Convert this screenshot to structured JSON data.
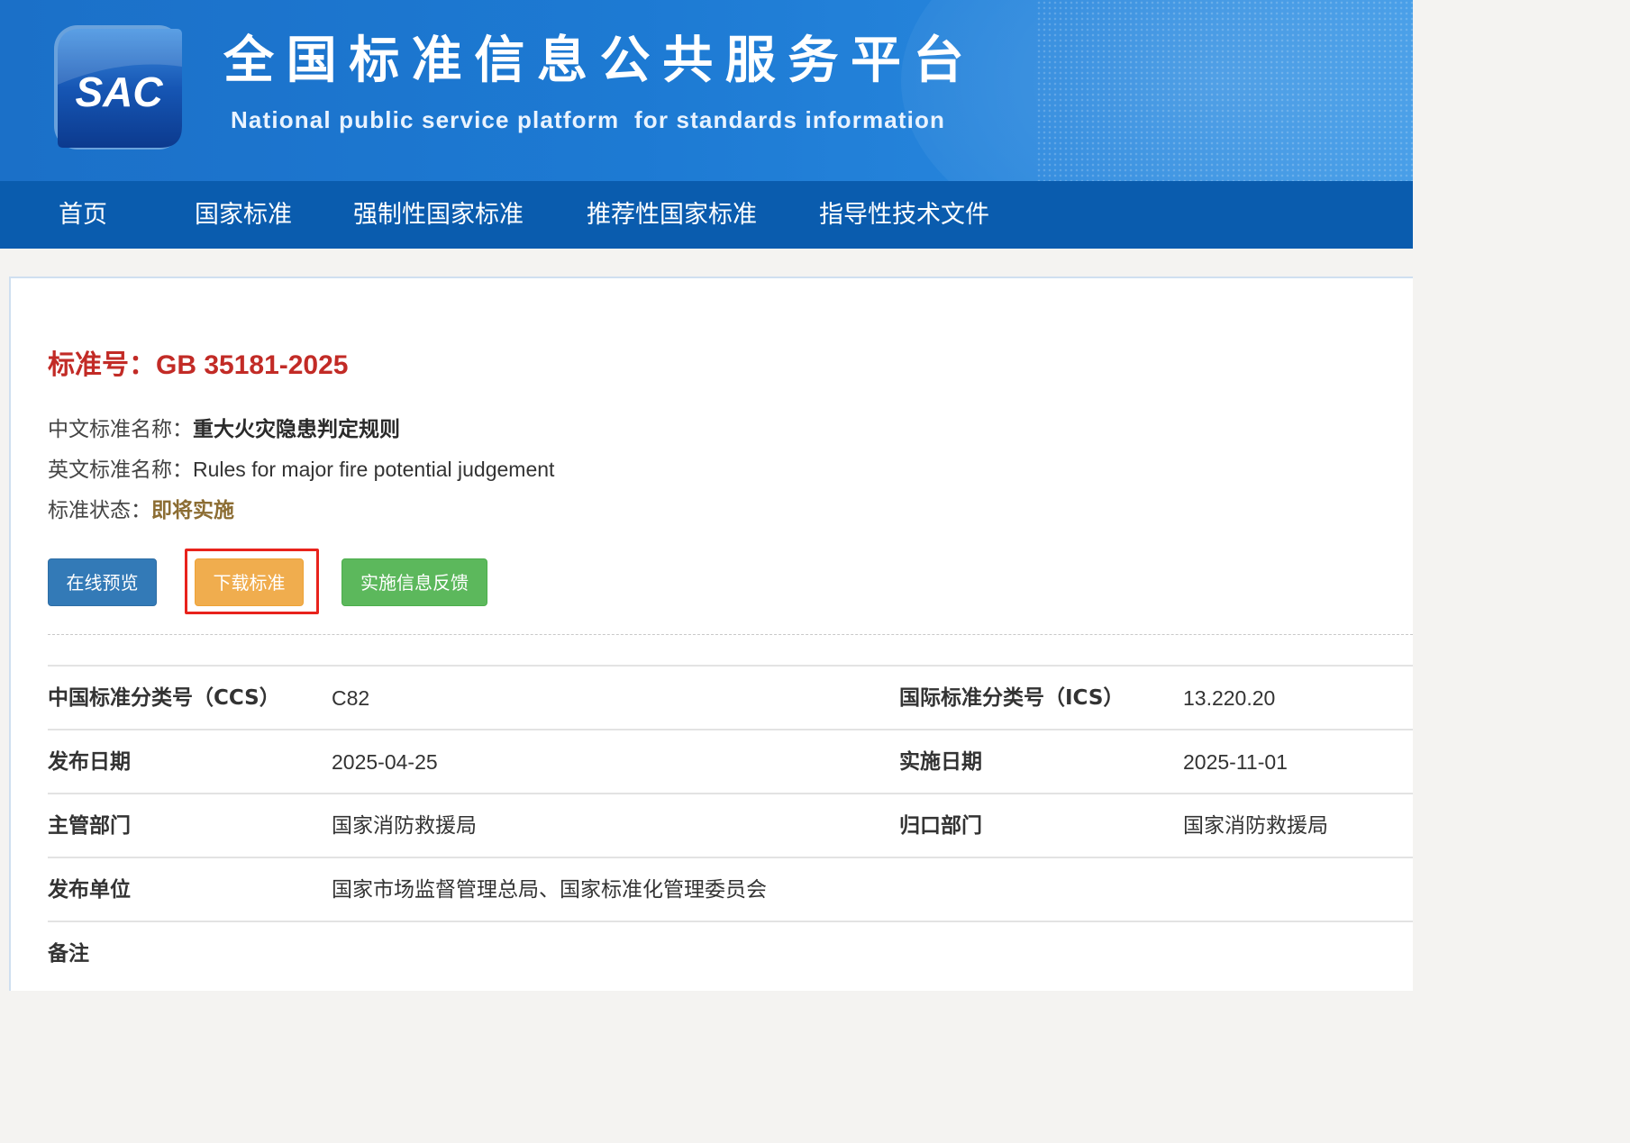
{
  "header": {
    "logo_text": "SAC",
    "title": "全国标准信息公共服务平台",
    "subtitle": "National public service platform  for standards information"
  },
  "nav": {
    "items": [
      {
        "label": "首页"
      },
      {
        "label": "国家标准"
      },
      {
        "label": "强制性国家标准"
      },
      {
        "label": "推荐性国家标准"
      },
      {
        "label": "指导性技术文件"
      }
    ]
  },
  "standard": {
    "number_label": "标准号：",
    "number": "GB 35181-2025",
    "cn_name_label": "中文标准名称：",
    "cn_name": "重大火灾隐患判定规则",
    "en_name_label": "英文标准名称：",
    "en_name": "Rules for major fire potential judgement",
    "status_label": "标准状态：",
    "status": "即将实施",
    "status_color": "#8c6d33"
  },
  "actions": {
    "preview": "在线预览",
    "download": "下载标准",
    "feedback": "实施信息反馈",
    "preview_color": "#337ab7",
    "download_color": "#f0ad4e",
    "feedback_color": "#5cb85c",
    "highlight_color": "#e8231c"
  },
  "details": {
    "ccs_label": "中国标准分类号（CCS）",
    "ccs_value": "C82",
    "ics_label": "国际标准分类号（ICS）",
    "ics_value": "13.220.20",
    "publish_date_label": "发布日期",
    "publish_date_value": "2025-04-25",
    "implement_date_label": "实施日期",
    "implement_date_value": "2025-11-01",
    "competent_dept_label": "主管部门",
    "competent_dept_value": "国家消防救援局",
    "responsible_dept_label": "归口部门",
    "responsible_dept_value": "国家消防救援局",
    "publisher_label": "发布单位",
    "publisher_value": "国家市场监督管理总局、国家标准化管理委员会",
    "remarks_label": "备注",
    "remarks_value": ""
  }
}
